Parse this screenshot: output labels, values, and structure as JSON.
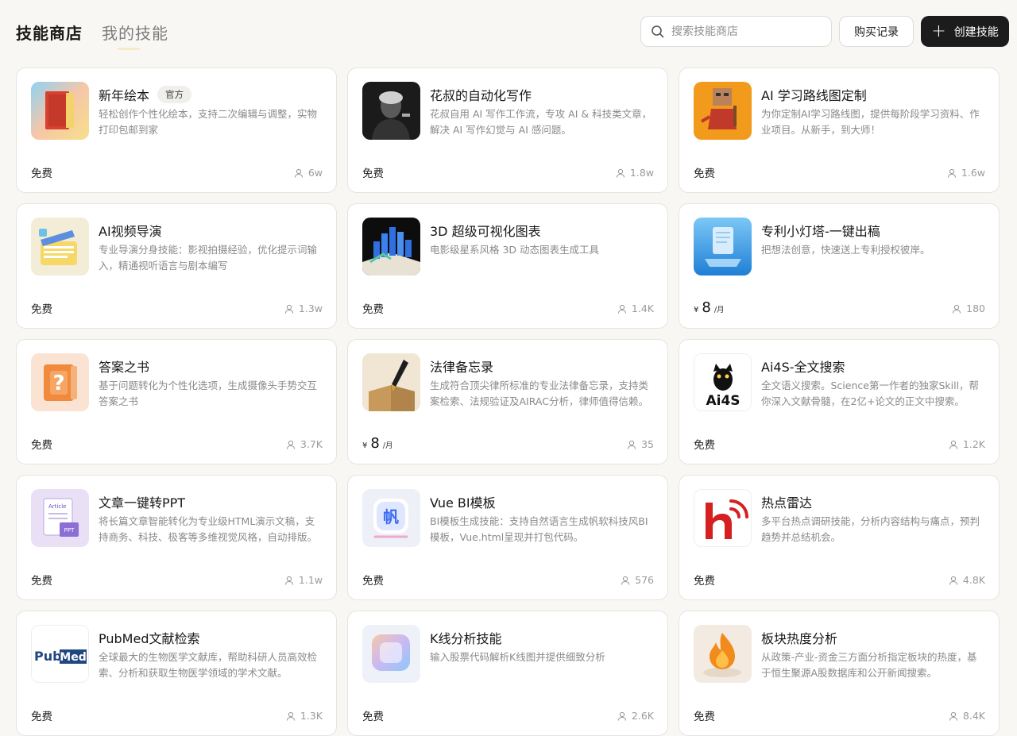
{
  "nav": {
    "tabs": [
      {
        "label": "技能商店"
      },
      {
        "label": "我的技能"
      }
    ]
  },
  "search": {
    "placeholder": "搜索技能商店"
  },
  "actions": {
    "history_label": "购买记录",
    "create_label": "创建技能"
  },
  "colors": {
    "background": "#f8f7f4",
    "primary_button": "#1c1c1c",
    "card_border": "#e6e4df",
    "muted_text": "#8a8a8a"
  },
  "cards": [
    {
      "title": "新年绘本",
      "badge": "官方",
      "desc": "轻松创作个性化绘本，支持二次编辑与调整，实物打印包邮到家",
      "price": "免费",
      "users": "6w",
      "icon": "picture-book-thumbnail"
    },
    {
      "title": "花叔的自动化写作",
      "desc": "花叔自用 AI 写作工作流，专攻 AI & 科技类文章，解决 AI 写作幻觉与 AI 感问题。",
      "price": "免费",
      "users": "1.8w",
      "icon": "portrait-photo-thumbnail"
    },
    {
      "title": "AI 学习路线图定制",
      "desc": "为你定制AI学习路线图，提供每阶段学习资料、作业项目。从新手，到大师！",
      "price": "免费",
      "users": "1.6w",
      "icon": "lobster-character-thumbnail"
    },
    {
      "title": "AI视频导演",
      "desc": "专业导演分身技能：影视拍摄经验，优化提示词输入，精通视听语言与剧本编写",
      "price": "免费",
      "users": "1.3w",
      "icon": "clapperboard-thumbnail"
    },
    {
      "title": "3D 超级可视化图表",
      "desc": "电影级星系风格 3D 动态图表生成工具",
      "price": "免费",
      "users": "1.4K",
      "icon": "3d-bar-chart-thumbnail"
    },
    {
      "title": "专利小灯塔-一键出稿",
      "desc": "把想法创意，快速送上专利授权彼岸。",
      "price_currency": "¥",
      "price_amount": "8",
      "price_unit": "/月",
      "users": "180",
      "icon": "glass-document-thumbnail"
    },
    {
      "title": "答案之书",
      "desc": "基于问题转化为个性化选项，生成摄像头手势交互答案之书",
      "price": "免费",
      "users": "3.7K",
      "icon": "question-book-thumbnail"
    },
    {
      "title": "法律备忘录",
      "desc": "生成符合顶尖律所标准的专业法律备忘录，支持类案检索、法规验证及AIRAC分析，律师值得信赖。",
      "price_currency": "¥",
      "price_amount": "8",
      "price_unit": "/月",
      "users": "35",
      "icon": "fountain-pen-thumbnail"
    },
    {
      "title": "Ai4S-全文搜索",
      "desc": "全文语义搜索。Science第一作者的独家Skill，帮你深入文献骨髓，在2亿+论文的正文中搜索。",
      "price": "免费",
      "users": "1.2K",
      "icon": "ai4s-cat-logo",
      "logo_text": "Ai4S"
    },
    {
      "title": "文章一键转PPT",
      "desc": "将长篇文章智能转化为专业级HTML演示文稿，支持商务、科技、极客等多维视觉风格，自动排版。",
      "price": "免费",
      "users": "1.1w",
      "icon": "article-ppt-thumbnail",
      "logo_text": "Article",
      "logo_text_2": "PPT"
    },
    {
      "title": "Vue BI模板",
      "desc": "BI模板生成技能：支持自然语言生成帆软科技风BI模板，Vue.html呈现并打包代码。",
      "price": "免费",
      "users": "576",
      "icon": "fan-app-thumbnail",
      "logo_text": "帆"
    },
    {
      "title": "热点雷达",
      "desc": "多平台热点调研技能，分析内容结构与痛点，预判趋势并总结机会。",
      "price": "免费",
      "users": "4.8K",
      "icon": "radar-h-logo"
    },
    {
      "title": "PubMed文献检索",
      "desc": "全球最大的生物医学文献库，帮助科研人员高效检索、分析和获取生物医学领域的学术文献。",
      "price": "免费",
      "users": "1.3K",
      "icon": "pubmed-logo",
      "logo_text": "Pub",
      "logo_text_2": "Med"
    },
    {
      "title": "K线分析技能",
      "desc": "输入股票代码解析K线图并提供细致分析",
      "price": "免费",
      "users": "2.6K",
      "icon": "gradient-square-thumbnail"
    },
    {
      "title": "板块热度分析",
      "desc": "从政策-产业-资金三方面分析指定板块的热度，基于恒生聚源A股数据库和公开新闻搜索。",
      "price": "免费",
      "users": "8.4K",
      "icon": "flame-thumbnail"
    }
  ]
}
